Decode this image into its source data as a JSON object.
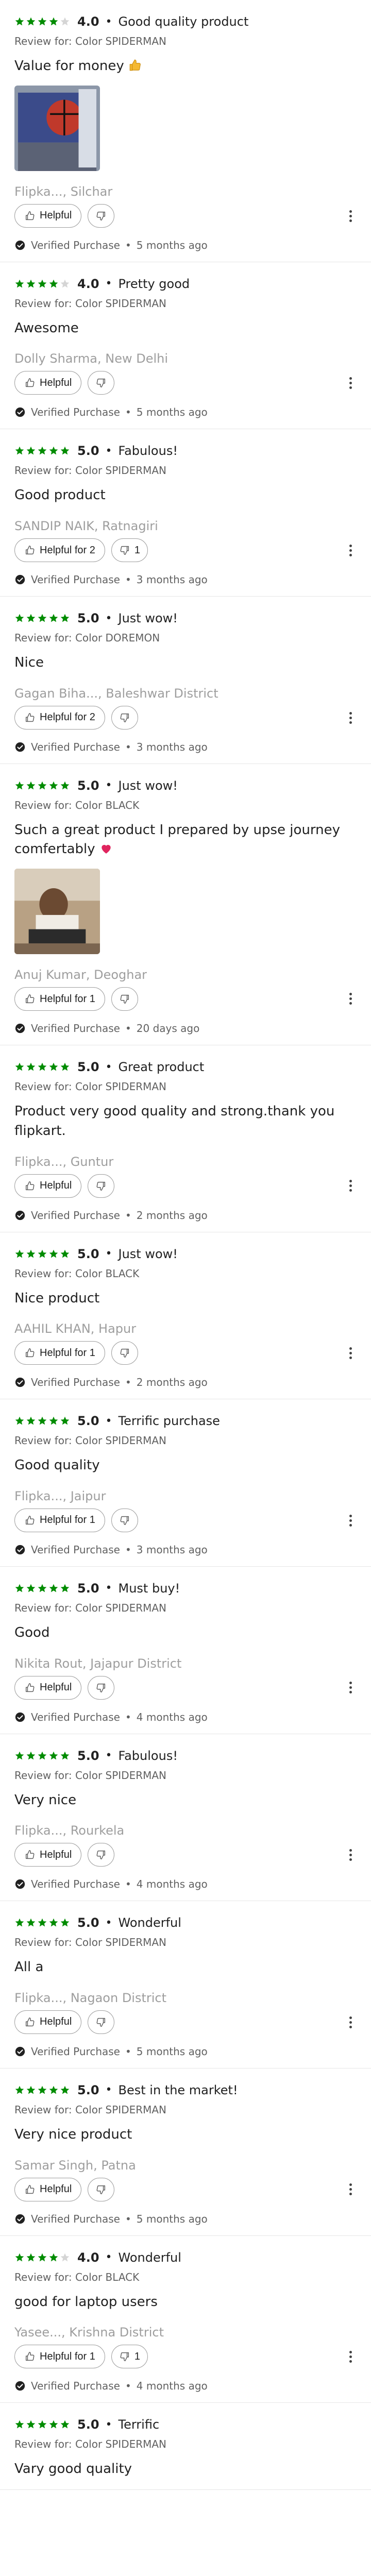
{
  "colors": {
    "star_filled": "#008c00",
    "star_empty": "#d5d5d5",
    "verified_check": "#212121"
  },
  "icons": {
    "star": "star-icon",
    "thumbs_up": "thumbs-up-icon",
    "thumbs_down": "thumbs-down-icon",
    "more": "more-vertical-icon",
    "verified": "verified-check-icon",
    "heart": "heart-emoji",
    "thumbs_emoji": "thumbs-up-emoji"
  },
  "separator": "•",
  "reviews": [
    {
      "rating": 4,
      "rating_label": "4.0",
      "title": "Good quality product",
      "variant": "Review for: Color SPIDERMAN",
      "text": "Value for money",
      "emoji": "thumbs-up-emoji",
      "photos": [
        "product-photo-spiderman-wall"
      ],
      "author": "Flipka..., Silchar",
      "helpful_label": "Helpful",
      "dislikes": "",
      "verified": "Verified Purchase",
      "time": "5 months ago"
    },
    {
      "rating": 4,
      "rating_label": "4.0",
      "title": "Pretty good",
      "variant": "Review for: Color SPIDERMAN",
      "text": "Awesome",
      "emoji": "",
      "photos": [],
      "author": "Dolly Sharma, New Delhi",
      "helpful_label": "Helpful",
      "dislikes": "",
      "verified": "Verified Purchase",
      "time": "5 months ago"
    },
    {
      "rating": 5,
      "rating_label": "5.0",
      "title": "Fabulous!",
      "variant": "Review for: Color SPIDERMAN",
      "text": "Good product",
      "emoji": "",
      "photos": [],
      "author": "SANDIP NAIK, Ratnagiri",
      "helpful_label": "Helpful for 2",
      "dislikes": "1",
      "verified": "Verified Purchase",
      "time": "3 months ago"
    },
    {
      "rating": 5,
      "rating_label": "5.0",
      "title": "Just wow!",
      "variant": "Review for: Color DOREMON",
      "text": "Nice",
      "emoji": "",
      "photos": [],
      "author": "Gagan Biha..., Baleshwar District",
      "helpful_label": "Helpful for 2",
      "dislikes": "",
      "verified": "Verified Purchase",
      "time": "3 months ago"
    },
    {
      "rating": 5,
      "rating_label": "5.0",
      "title": "Just wow!",
      "variant": "Review for: Color BLACK",
      "text": "Such a great product I prepared by upse journey comfertably",
      "emoji": "heart-emoji",
      "photos": [
        "product-photo-laptop-table"
      ],
      "author": "Anuj Kumar, Deoghar",
      "helpful_label": "Helpful for 1",
      "dislikes": "",
      "verified": "Verified Purchase",
      "time": "20 days ago"
    },
    {
      "rating": 5,
      "rating_label": "5.0",
      "title": "Great product",
      "variant": "Review for: Color SPIDERMAN",
      "text": "Product very good quality and strong.thank you flipkart.",
      "emoji": "",
      "photos": [],
      "author": "Flipka..., Guntur",
      "helpful_label": "Helpful",
      "dislikes": "",
      "verified": "Verified Purchase",
      "time": "2 months ago"
    },
    {
      "rating": 5,
      "rating_label": "5.0",
      "title": "Just wow!",
      "variant": "Review for: Color BLACK",
      "text": "Nice product",
      "emoji": "",
      "photos": [],
      "author": "AAHIL KHAN, Hapur",
      "helpful_label": "Helpful for 1",
      "dislikes": "",
      "verified": "Verified Purchase",
      "time": "2 months ago"
    },
    {
      "rating": 5,
      "rating_label": "5.0",
      "title": "Terrific purchase",
      "variant": "Review for: Color SPIDERMAN",
      "text": "Good quality",
      "emoji": "",
      "photos": [],
      "author": "Flipka..., Jaipur",
      "helpful_label": "Helpful for 1",
      "dislikes": "",
      "verified": "Verified Purchase",
      "time": "3 months ago"
    },
    {
      "rating": 5,
      "rating_label": "5.0",
      "title": "Must buy!",
      "variant": "Review for: Color SPIDERMAN",
      "text": "Good",
      "emoji": "",
      "photos": [],
      "author": "Nikita Rout, Jajapur District",
      "helpful_label": "Helpful",
      "dislikes": "",
      "verified": "Verified Purchase",
      "time": "4 months ago"
    },
    {
      "rating": 5,
      "rating_label": "5.0",
      "title": "Fabulous!",
      "variant": "Review for: Color SPIDERMAN",
      "text": "Very nice",
      "emoji": "",
      "photos": [],
      "author": "Flipka..., Rourkela",
      "helpful_label": "Helpful",
      "dislikes": "",
      "verified": "Verified Purchase",
      "time": "4 months ago"
    },
    {
      "rating": 5,
      "rating_label": "5.0",
      "title": "Wonderful",
      "variant": "Review for: Color SPIDERMAN",
      "text": "All a",
      "emoji": "",
      "photos": [],
      "author": "Flipka..., Nagaon District",
      "helpful_label": "Helpful",
      "dislikes": "",
      "verified": "Verified Purchase",
      "time": "5 months ago"
    },
    {
      "rating": 5,
      "rating_label": "5.0",
      "title": "Best in the market!",
      "variant": "Review for: Color SPIDERMAN",
      "text": "Very nice product",
      "emoji": "",
      "photos": [],
      "author": "Samar Singh, Patna",
      "helpful_label": "Helpful",
      "dislikes": "",
      "verified": "Verified Purchase",
      "time": "5 months ago"
    },
    {
      "rating": 4,
      "rating_label": "4.0",
      "title": "Wonderful",
      "variant": "Review for: Color BLACK",
      "text": "good for laptop users",
      "emoji": "",
      "photos": [],
      "author": "Yasee..., Krishna District",
      "helpful_label": "Helpful for 1",
      "dislikes": "1",
      "verified": "Verified Purchase",
      "time": "4 months ago"
    },
    {
      "rating": 5,
      "rating_label": "5.0",
      "title": "Terrific",
      "variant": "Review for: Color SPIDERMAN",
      "text": "Vary good quality",
      "emoji": "",
      "photos": [],
      "author": "",
      "helpful_label": "",
      "dislikes": "",
      "verified": "",
      "time": ""
    }
  ]
}
